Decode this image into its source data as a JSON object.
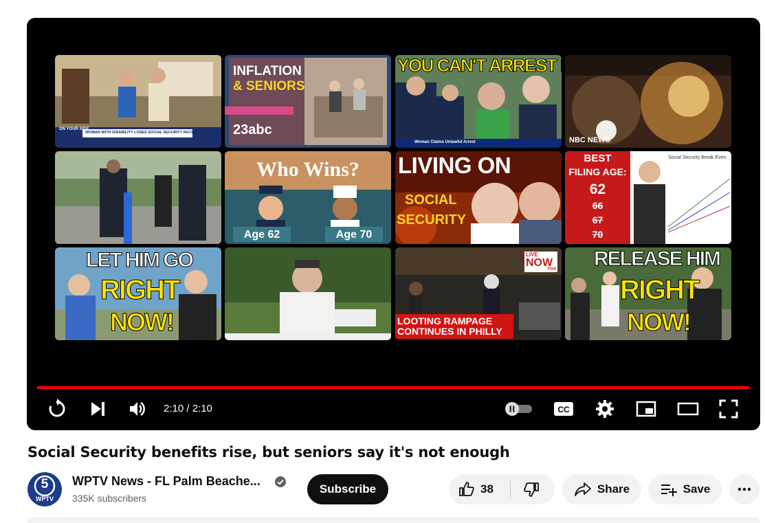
{
  "player": {
    "time_display": "2:10 / 2:10",
    "progress_fraction": 1.0,
    "endscreen": [
      {
        "id": "t1",
        "texts": [
          "ON YOUR SIDE",
          "WOMAN WITH DISABILITY LOSES SOCIAL SECURITY INCOME"
        ]
      },
      {
        "id": "t2",
        "texts": [
          "INFLATION",
          "& SENIORS",
          "23abc"
        ]
      },
      {
        "id": "t3",
        "texts": [
          "YOU CAN'T ARREST ME",
          "Woman Claims Unlawful Arrest"
        ]
      },
      {
        "id": "t4",
        "texts": [
          "NBC NEWS"
        ]
      },
      {
        "id": "t5",
        "texts": []
      },
      {
        "id": "t6",
        "texts": [
          "Who Wins?",
          "Age 62",
          "Age 70"
        ]
      },
      {
        "id": "t7",
        "texts": [
          "LIVING ON",
          "SOCIAL",
          "SECURITY"
        ]
      },
      {
        "id": "t8",
        "texts": [
          "BEST",
          "FILING AGE:",
          "62",
          "66",
          "67",
          "70",
          "Social Security Break Even"
        ]
      },
      {
        "id": "t9",
        "texts": [
          "LET HIM GO",
          "RIGHT",
          "NOW!"
        ]
      },
      {
        "id": "t10",
        "texts": []
      },
      {
        "id": "t11",
        "texts": [
          "LIVE",
          "NOW",
          "FOX",
          "LOOTING RAMPAGE",
          "CONTINUES IN PHILLY"
        ]
      },
      {
        "id": "t12",
        "texts": [
          "RELEASE HIM",
          "RIGHT",
          "NOW!"
        ]
      }
    ],
    "icons": [
      "replay-icon",
      "next-icon",
      "volume-icon",
      "autoplay-toggle",
      "captions-icon",
      "settings-icon",
      "miniplayer-icon",
      "theater-icon",
      "fullscreen-icon"
    ],
    "accent": "#ff0000"
  },
  "video": {
    "title": "Social Security benefits rise, but seniors say it's not enough"
  },
  "channel": {
    "name": "WPTV News - FL Palm Beache...",
    "subscribers": "335K subscribers",
    "avatar_text": "WPTV",
    "avatar_number": "5"
  },
  "actions": {
    "subscribe": "Subscribe",
    "likes": "38",
    "share": "Share",
    "save": "Save"
  }
}
